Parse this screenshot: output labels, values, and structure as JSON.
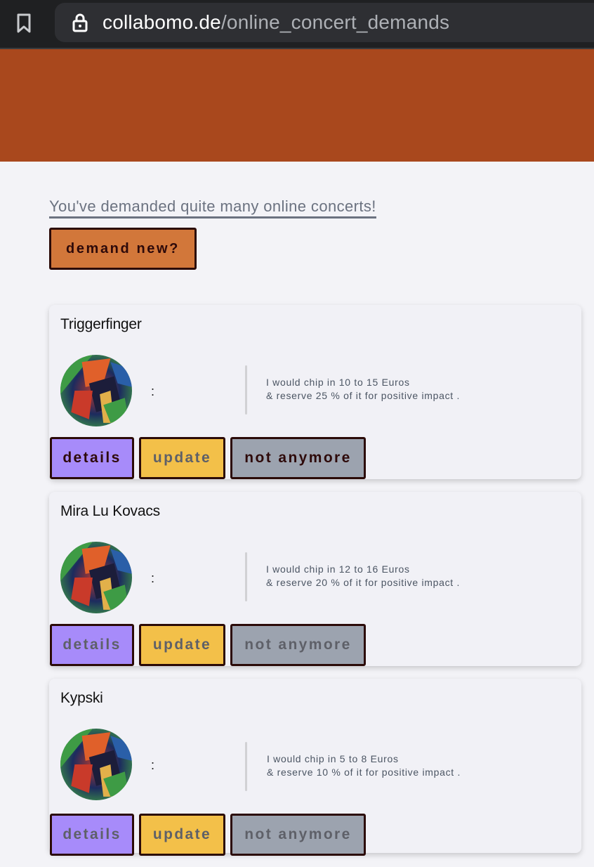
{
  "browser": {
    "url_domain": "collabomo.de",
    "url_path": "/online_concert_demands"
  },
  "page": {
    "headline": "You've demanded quite many online concerts!",
    "demand_button": "demand new?"
  },
  "cards": [
    {
      "artist": "Triggerfinger",
      "colon": ":",
      "offer_line1": "I would chip in 10 to 15 Euros",
      "offer_line2": "& reserve 25 % of it for positive impact .",
      "details_label": "details",
      "update_label": "update",
      "not_anymore_label": "not anymore"
    },
    {
      "artist": "Mira Lu Kovacs",
      "colon": ":",
      "offer_line1": "I would chip in 12 to 16 Euros",
      "offer_line2": "& reserve 20 % of it for positive impact .",
      "details_label": "details",
      "update_label": "update",
      "not_anymore_label": "not anymore"
    },
    {
      "artist": "Kypski",
      "colon": ":",
      "offer_line1": "I would chip in 5 to 8 Euros",
      "offer_line2": "& reserve 10 % of it for positive impact .",
      "details_label": "details",
      "update_label": "update",
      "not_anymore_label": "not anymore"
    }
  ],
  "icons": {
    "bookmark": "bookmark-icon",
    "lock": "lock-icon"
  },
  "colors": {
    "banner": "#a9481d",
    "demand_button": "#d2773a",
    "details_button": "#a78bfa",
    "update_button": "#f3c049",
    "not_anymore_button": "#9ca3af"
  }
}
